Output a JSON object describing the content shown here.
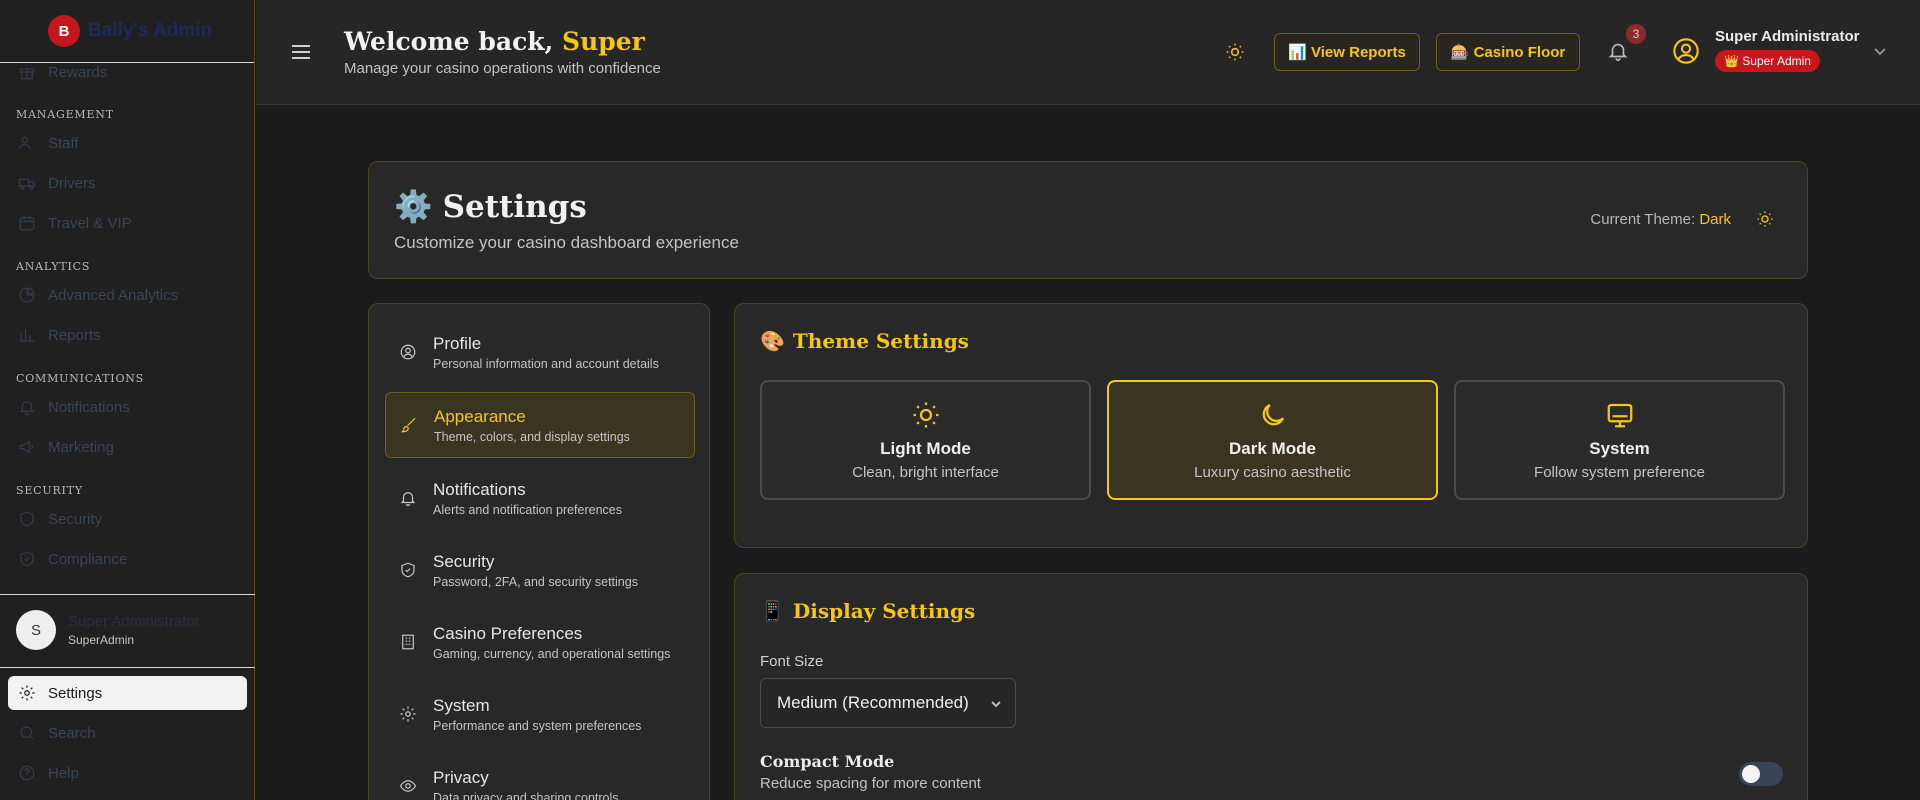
{
  "brand": {
    "logo_letter": "B",
    "name": "Bally's Admin"
  },
  "sidebar": {
    "top_item": "Rewards",
    "sections": [
      {
        "title": "MANAGEMENT",
        "items": [
          "Staff",
          "Drivers",
          "Travel & VIP"
        ]
      },
      {
        "title": "ANALYTICS",
        "items": [
          "Advanced Analytics",
          "Reports"
        ]
      },
      {
        "title": "COMMUNICATIONS",
        "items": [
          "Notifications",
          "Marketing"
        ]
      },
      {
        "title": "SECURITY",
        "items": [
          "Security",
          "Compliance"
        ]
      }
    ],
    "user": {
      "initial": "S",
      "name": "Super Administrator",
      "role": "SuperAdmin"
    },
    "bottom_items": [
      "Settings",
      "Search",
      "Help"
    ],
    "active_item": "Settings"
  },
  "header": {
    "welcome_prefix": "Welcome back,",
    "welcome_name": "Super",
    "subtitle": "Manage your casino operations with confidence",
    "view_reports": "📊 View Reports",
    "casino_floor": "🎰 Casino Floor",
    "notification_count": "3",
    "user_name": "Super Administrator",
    "user_role": "👑 Super Admin"
  },
  "settings": {
    "title_icon": "⚙️",
    "title": "Settings",
    "subtitle": "Customize your casino dashboard experience",
    "current_theme_label": "Current Theme:",
    "current_theme_value": "Dark"
  },
  "nav": [
    {
      "label": "Profile",
      "desc": "Personal information and account details",
      "icon": "user-circle-icon"
    },
    {
      "label": "Appearance",
      "desc": "Theme, colors, and display settings",
      "icon": "brush-icon",
      "active": true
    },
    {
      "label": "Notifications",
      "desc": "Alerts and notification preferences",
      "icon": "bell-icon"
    },
    {
      "label": "Security",
      "desc": "Password, 2FA, and security settings",
      "icon": "shield-check-icon"
    },
    {
      "label": "Casino Preferences",
      "desc": "Gaming, currency, and operational settings",
      "icon": "building-icon"
    },
    {
      "label": "System",
      "desc": "Performance and system preferences",
      "icon": "gear-icon"
    },
    {
      "label": "Privacy",
      "desc": "Data privacy and sharing controls",
      "icon": "eye-icon"
    }
  ],
  "theme_settings": {
    "icon": "🎨",
    "title": "Theme Settings",
    "options": [
      {
        "name": "Light Mode",
        "desc": "Clean, bright interface",
        "icon": "sun-icon"
      },
      {
        "name": "Dark Mode",
        "desc": "Luxury casino aesthetic",
        "icon": "moon-icon",
        "selected": true
      },
      {
        "name": "System",
        "desc": "Follow system preference",
        "icon": "monitor-icon"
      }
    ]
  },
  "display_settings": {
    "icon": "📱",
    "title": "Display Settings",
    "font_size_label": "Font Size",
    "font_size_value": "Medium (Recommended)",
    "compact_title": "Compact Mode",
    "compact_desc": "Reduce spacing for more content",
    "compact_enabled": false
  },
  "colors": {
    "accent": "#f5c518",
    "danger": "#c8161d",
    "background": "#1b1b1b"
  }
}
